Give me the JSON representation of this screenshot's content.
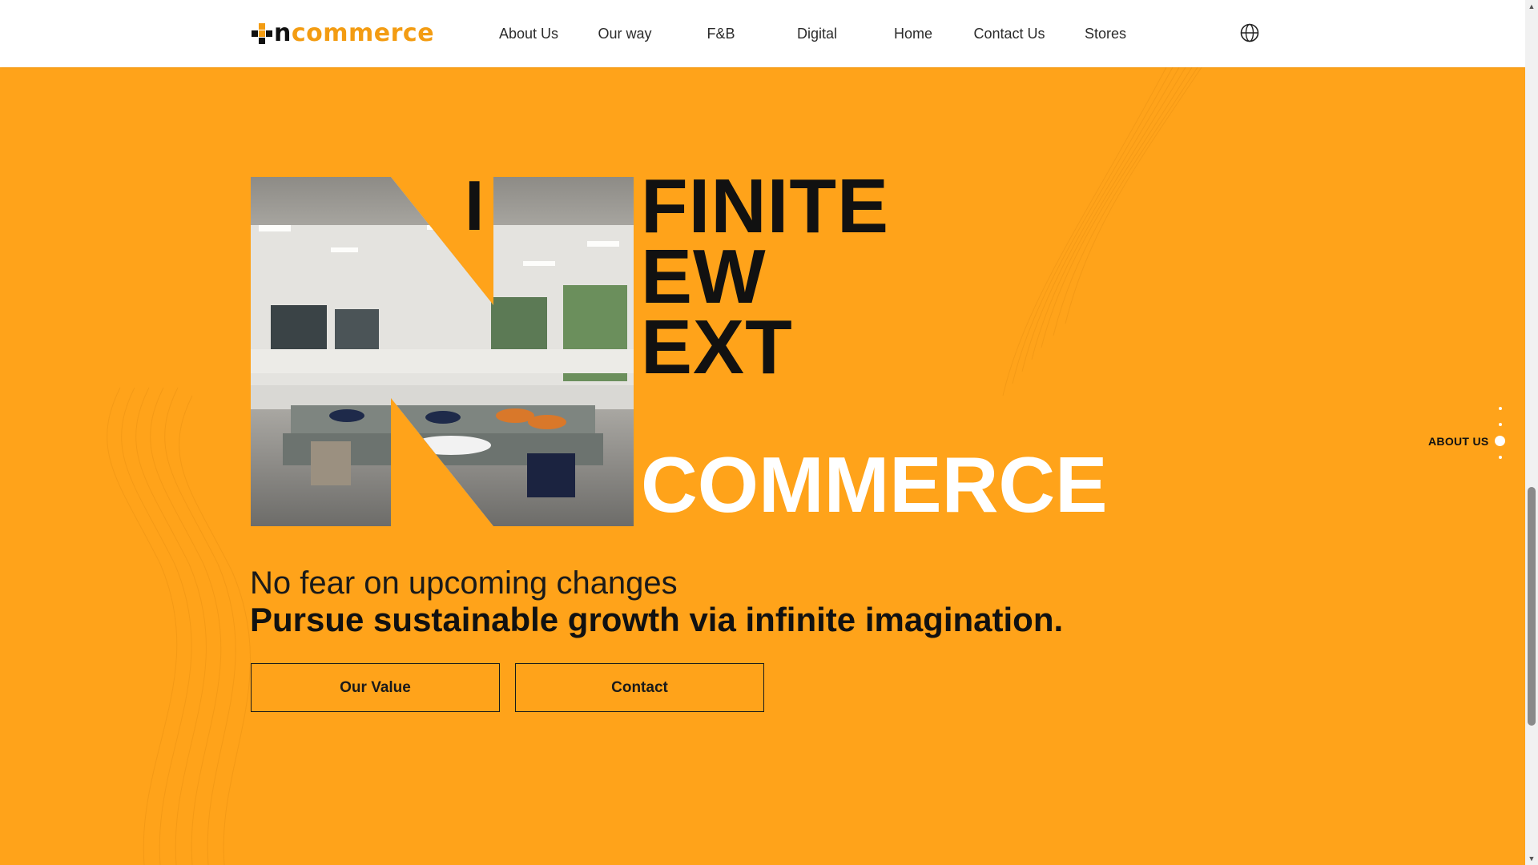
{
  "header": {
    "logo": {
      "prefix": "n",
      "rest": "commerce"
    },
    "nav": [
      "About Us",
      "Our way",
      "F&B",
      "Digital",
      "Home",
      "Contact Us",
      "Stores"
    ],
    "language_icon": "globe-icon"
  },
  "hero": {
    "letter_i": "I",
    "line_finite": "FINITE",
    "line_ew": "EW",
    "line_ext": "EXT",
    "commerce": "COMMERCE",
    "tagline_light": "No fear on upcoming changes",
    "tagline_bold": "Pursue sustainable growth via infinite imagination.",
    "buttons": {
      "value": "Our Value",
      "contact": "Contact"
    }
  },
  "side_nav": {
    "active_label": "ABOUT US",
    "dot_count": 4,
    "active_index": 2
  },
  "colors": {
    "accent": "#FFA31A",
    "logo_orange": "#F39C12",
    "text_dark": "#111111",
    "white": "#FFFFFF"
  }
}
